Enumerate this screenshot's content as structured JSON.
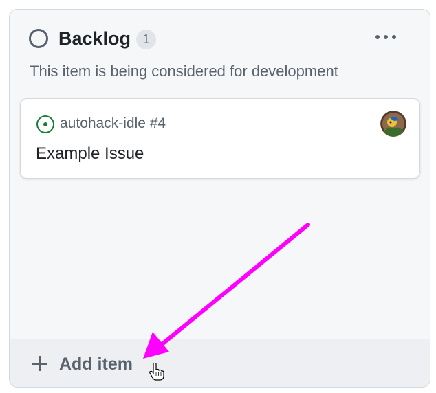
{
  "column": {
    "title": "Backlog",
    "count": "1",
    "description": "This item is being considered for development",
    "more_icon": "kebab-horizontal-icon",
    "status_icon": "circle-outline-icon"
  },
  "cards": [
    {
      "repo_ref": "autohack-idle #4",
      "title": "Example Issue",
      "state_icon": "issue-opened-icon",
      "state_color": "#1a7f37"
    }
  ],
  "add_item": {
    "label": "Add item",
    "icon": "plus-icon"
  },
  "annotation": {
    "arrow_color": "#ff00ff"
  },
  "colors": {
    "column_bg": "#f6f7f9",
    "border": "#d4d9df",
    "muted_text": "#59636e",
    "primary_text": "#1f2328"
  }
}
